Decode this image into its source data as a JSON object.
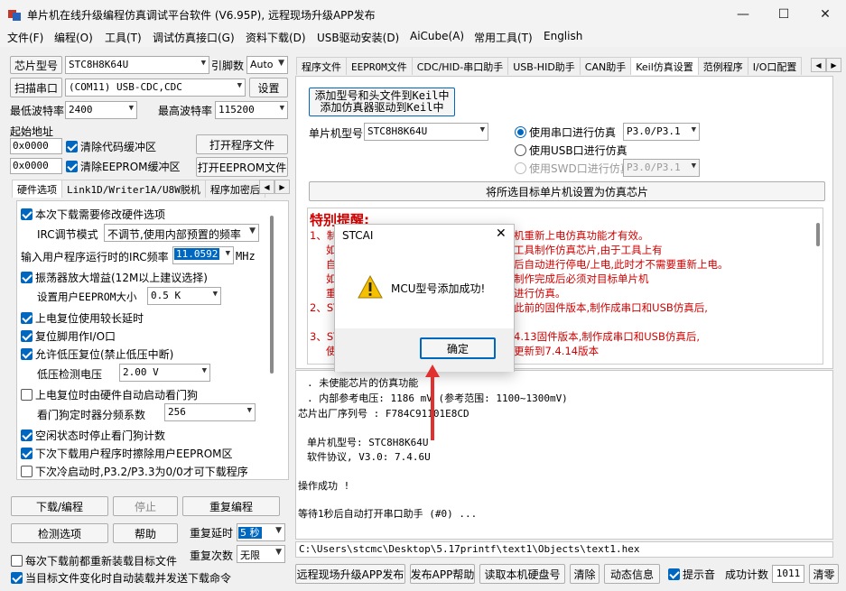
{
  "window": {
    "title": "单片机在线升级编程仿真调试平台软件 (V6.95P), 远程现场升级APP发布"
  },
  "menu": [
    "文件(F)",
    "编程(O)",
    "工具(T)",
    "调试仿真接口(G)",
    "资料下载(D)",
    "USB驱动安装(D)",
    "AiCube(A)",
    "常用工具(T)",
    "English"
  ],
  "left": {
    "chip_label": "芯片型号",
    "chip_value": "STC8H8K64U",
    "pin_label": "引脚数",
    "pin_value": "Auto",
    "scan_btn": "扫描串口",
    "port_value": "(COM11) USB-CDC,CDC",
    "settings_btn": "设置",
    "min_baud_label": "最低波特率",
    "min_baud": "2400",
    "max_baud_label": "最高波特率",
    "max_baud": "115200",
    "start_addr_label": "起始地址",
    "addr1": "0x0000",
    "clear_code": "清除代码缓冲区",
    "open_prog_btn": "打开程序文件",
    "addr2": "0x0000",
    "clear_eeprom": "清除EEPROM缓冲区",
    "open_eeprom_btn": "打开EEPROM文件",
    "tabs": [
      "硬件选项",
      "Link1D/Writer1A/U8W脱机",
      "程序加密后"
    ],
    "hw": {
      "opt1": "本次下载需要修改硬件选项",
      "irc_mode_label": "IRC调节模式",
      "irc_mode_value": "不调节,使用内部预置的频率",
      "irc_freq_label": "输入用户程序运行时的IRC频率",
      "irc_freq_value": "11.0592",
      "irc_unit": "MHz",
      "opt2": "振荡器放大增益(12M以上建议选择)",
      "eeprom_size_label": "设置用户EEPROM大小",
      "eeprom_size_value": "0.5 K",
      "opt3": "上电复位使用较长延时",
      "opt4": "复位脚用作I/O口",
      "opt5": "允许低压复位(禁止低压中断)",
      "lvd_label": "低压检测电压",
      "lvd_value": "2.00 V",
      "opt6": "上电复位时由硬件自动启动看门狗",
      "wdt_label": "看门狗定时器分频系数",
      "wdt_value": "256",
      "opt7": "空闲状态时停止看门狗计数",
      "opt8": "下次下载用户程序时擦除用户EEPROM区",
      "opt9": "下次冷启动时,P3.2/P3.3为0/0才可下载程序"
    },
    "download_btn": "下载/编程",
    "stop_btn": "停止",
    "reprogram_btn": "重复编程",
    "check_btn": "检测选项",
    "help_btn": "帮助",
    "repeat_delay_label": "重复延时",
    "repeat_delay_value": "5 秒",
    "repeat_count_label": "重复次数",
    "repeat_count_value": "无限",
    "reload_each": "每次下载前都重新装载目标文件",
    "auto_reload": "当目标文件变化时自动装载并发送下载命令"
  },
  "right": {
    "tabs": [
      "程序文件",
      "EEPROM文件",
      "CDC/HID-串口助手",
      "USB-HID助手",
      "CAN助手",
      "Keil仿真设置",
      "范例程序",
      "I/O口配置"
    ],
    "add_btn_line1": "添加型号和头文件到Keil中",
    "add_btn_line2": "添加仿真器驱动到Keil中",
    "mcu_label": "单片机型号",
    "mcu_value": "STC8H8K64U",
    "radio1": "使用串口进行仿真",
    "radio1_value": "P3.0/P3.1",
    "radio2": "使用USB口进行仿真",
    "radio3": "使用SWD口进行仿真",
    "radio3_value": "P3.0/P3.1",
    "set_emulator_btn": "将所选目标单片机设置为仿真芯片",
    "warn_title": "特别提醒:",
    "warn_lines": [
      "1、制",
      "如",
      "自",
      "如",
      "重",
      "2、ST",
      "3、ST",
      "使"
    ],
    "warn_tails": [
      "机重新上电仿真功能才有效。",
      "工具制作仿真芯片,由于工具上有",
      "后自动进行停电/上电,此时才不需要重新上电。",
      "制作完成后必须对目标单片机",
      "进行仿真。",
      "此前的固件版本,制作成串口和USB仿真后,",
      "4.13固件版本,制作成串口和USB仿真后,",
      "更新到7.4.14版本"
    ]
  },
  "log": [
    ". 未使能芯片的仿真功能",
    ". 内部参考电压: 1186 mV (参考范围: 1100~1300mV)",
    "芯片出厂序列号 : F784C91101E8CD",
    "",
    "单片机型号: STC8H8K64U",
    "软件协议, V3.0: 7.4.6U",
    "",
    "操作成功 !",
    "",
    "等待1秒后自动打开串口助手 (#0) ..."
  ],
  "path": "C:\\Users\\stcmc\\Desktop\\5.17printf\\text1\\Objects\\text1.hex",
  "bottom": {
    "remote_btn": "远程现场升级APP发布",
    "publish_help_btn": "发布APP帮助",
    "read_disk_btn": "读取本机硬盘号",
    "clear_btn": "清除",
    "anim_btn": "动态信息",
    "beep": "提示音",
    "success_label": "成功计数",
    "success_count": "1011",
    "clear_count_btn": "清零"
  },
  "dialog": {
    "title": "STCAI",
    "message": "MCU型号添加成功!",
    "ok": "确定"
  },
  "colors": {
    "accent": "#0067c0",
    "warning_red": "#d00000",
    "arrow_red": "#e03030"
  }
}
